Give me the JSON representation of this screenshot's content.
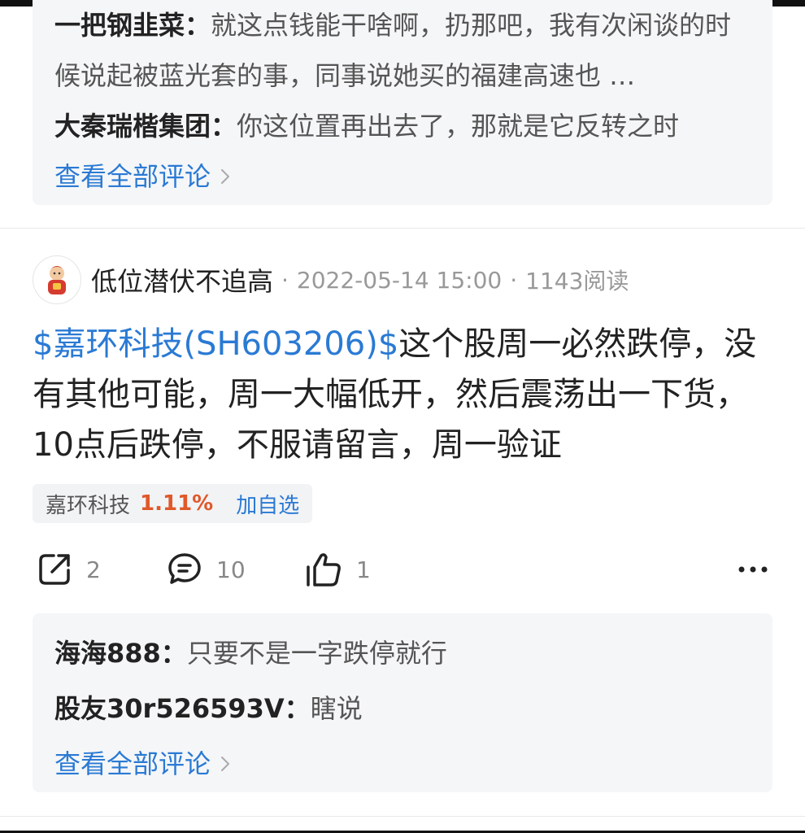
{
  "top_comments": {
    "items": [
      {
        "author": "一把钢韭菜：",
        "text": "就这点钱能干啥啊，扔那吧，我有次闲谈的时候说起被蓝光套的事，同事说她买的福建高速也 …"
      },
      {
        "author": "大秦瑞楷集团：",
        "text": "你这位置再出去了，那就是它反转之时"
      }
    ],
    "view_all": "查看全部评论"
  },
  "post": {
    "username": "低位潜伏不追高",
    "dot": "·",
    "datetime": "2022-05-14 15:00",
    "reads": "1143阅读",
    "stock_tag": "$嘉环科技(SH603206)$",
    "body": "这个股周一必然跌停，没有其他可能，周一大幅低开，然后震荡出一下货，10点后跌停，不服请留言，周一验证",
    "chip": {
      "name": "嘉环科技",
      "change": "1.11%",
      "add": "加自选"
    },
    "actions": {
      "share": "2",
      "comment": "10",
      "like": "1"
    }
  },
  "post_comments": {
    "items": [
      {
        "author": "海海888：",
        "text": "只要不是一字跌停就行"
      },
      {
        "author": "股友30r526593V：",
        "text": "瞎说"
      }
    ],
    "view_all": "查看全部评论"
  },
  "icons": {
    "share": "share-icon",
    "comment": "comment-icon",
    "like": "thumbs-up-icon",
    "more": "more-icon",
    "avatar": "avatar-icon",
    "chevron": "chevron-right-icon"
  },
  "colors": {
    "link": "#2a7ad4",
    "up": "#e0582a",
    "panel": "#f5f6f8"
  }
}
